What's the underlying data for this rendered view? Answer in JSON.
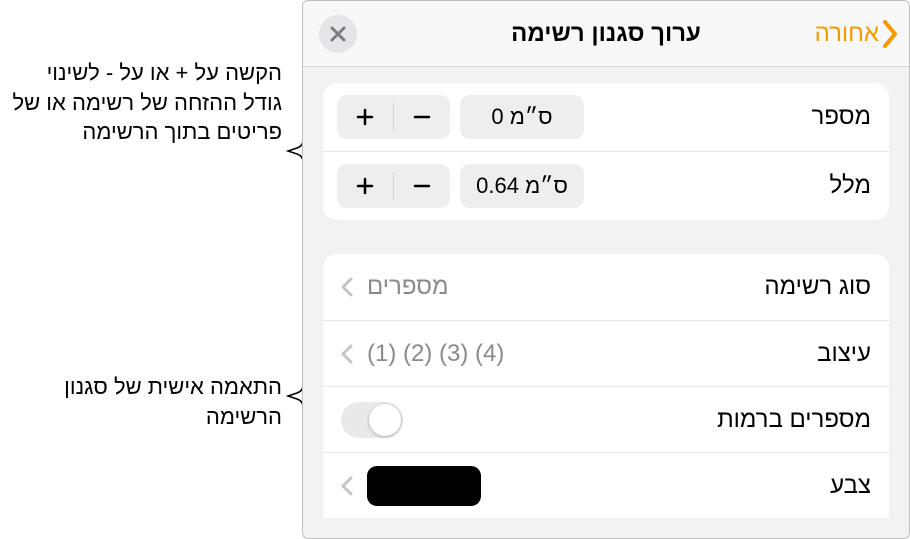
{
  "header": {
    "back_label": "אחורה",
    "title": "ערוך סגנון רשימה"
  },
  "steppers": {
    "number": {
      "label": "מספר",
      "value": "0 ס״מ"
    },
    "indent": {
      "label": "מלל",
      "value": "0.64 ס״מ"
    }
  },
  "style": {
    "list_type": {
      "label": "סוג רשימה",
      "value": "מספרים"
    },
    "format": {
      "label": "עיצוב",
      "value": "(1) (2) (3) (4)"
    },
    "tiered": {
      "label": "מספרים ברמות"
    },
    "color": {
      "label": "צבע",
      "swatch": "#000000"
    }
  },
  "callouts": {
    "c1": "הקשה על + או על - לשינוי גודל ההזחה של רשימה או של פריטים בתוך הרשימה",
    "c2": "התאמה אישית של סגנון הרשימה"
  }
}
